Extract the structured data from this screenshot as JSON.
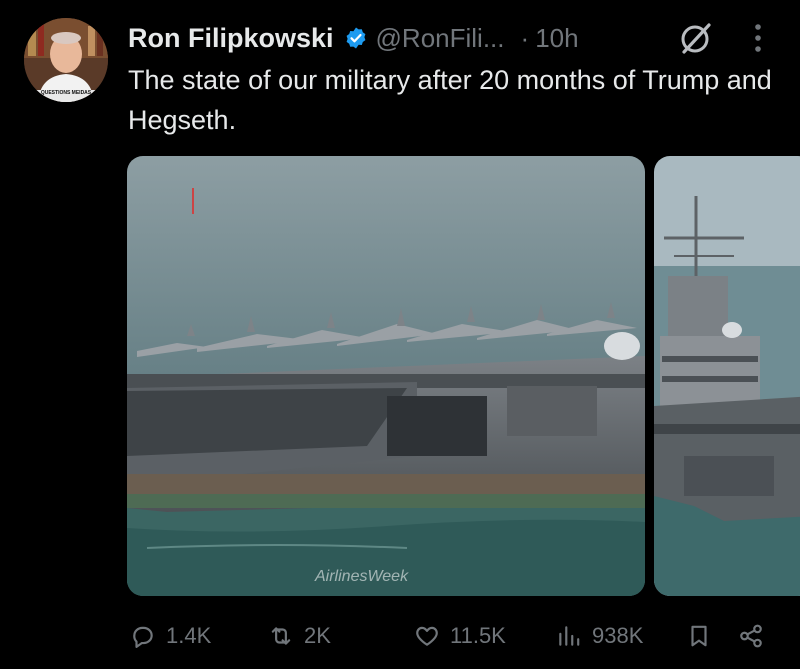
{
  "author": {
    "name": "Ron Filipkowski",
    "handle": "@RonFili...",
    "time": "10h",
    "avatar_caption": "QUESTIONS MEIDAS"
  },
  "tweet": {
    "text": "The state of our military after 20 months of Trump and Hegseth."
  },
  "media": {
    "watermark": "AirlinesWeek"
  },
  "actions": {
    "replies": "1.4K",
    "reposts": "2K",
    "likes": "11.5K",
    "views": "938K"
  },
  "icons": [
    "verified-icon",
    "grok-icon",
    "more-icon",
    "reply-icon",
    "repost-icon",
    "like-icon",
    "views-icon",
    "bookmark-icon",
    "share-icon"
  ],
  "colors": {
    "background": "#000000",
    "text": "#e7e9ea",
    "muted": "#71767b",
    "verified": "#1d9bf0"
  }
}
